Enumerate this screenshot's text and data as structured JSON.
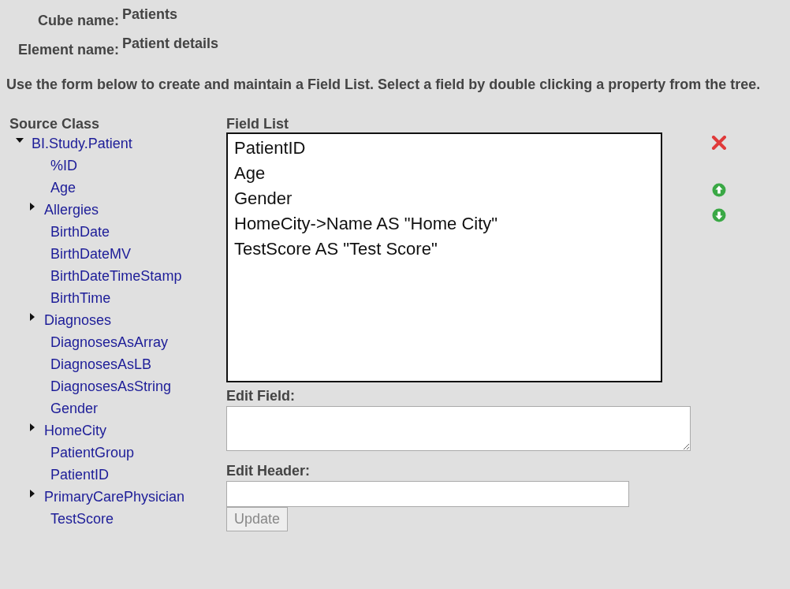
{
  "header": [
    {
      "label": "Cube name:",
      "value": "Patients"
    },
    {
      "label": "Element name:",
      "value": "Patient details"
    }
  ],
  "instructions": "Use the form below to create and maintain a Field List. Select a field by double clicking a property from the tree.",
  "source_class": {
    "title": "Source Class",
    "tree": [
      {
        "label": "BI.Study.Patient",
        "expanded": true,
        "children": [
          {
            "label": "%ID"
          },
          {
            "label": "Age"
          },
          {
            "label": "Allergies",
            "expanded": false
          },
          {
            "label": "BirthDate"
          },
          {
            "label": "BirthDateMV"
          },
          {
            "label": "BirthDateTimeStamp"
          },
          {
            "label": "BirthTime"
          },
          {
            "label": "Diagnoses",
            "expanded": false
          },
          {
            "label": "DiagnosesAsArray"
          },
          {
            "label": "DiagnosesAsLB"
          },
          {
            "label": "DiagnosesAsString"
          },
          {
            "label": "Gender"
          },
          {
            "label": "HomeCity",
            "expanded": false
          },
          {
            "label": "PatientGroup"
          },
          {
            "label": "PatientID"
          },
          {
            "label": "PrimaryCarePhysician",
            "expanded": false
          },
          {
            "label": "TestScore"
          }
        ]
      }
    ]
  },
  "field_list": {
    "title": "Field List",
    "items": [
      "PatientID",
      "Age",
      "Gender",
      "HomeCity->Name AS \"Home City\"",
      "TestScore AS \"Test Score\""
    ]
  },
  "edit_field": {
    "label": "Edit Field:"
  },
  "edit_header": {
    "label": "Edit Header:"
  },
  "update_button": {
    "label": "Update",
    "disabled": true
  }
}
